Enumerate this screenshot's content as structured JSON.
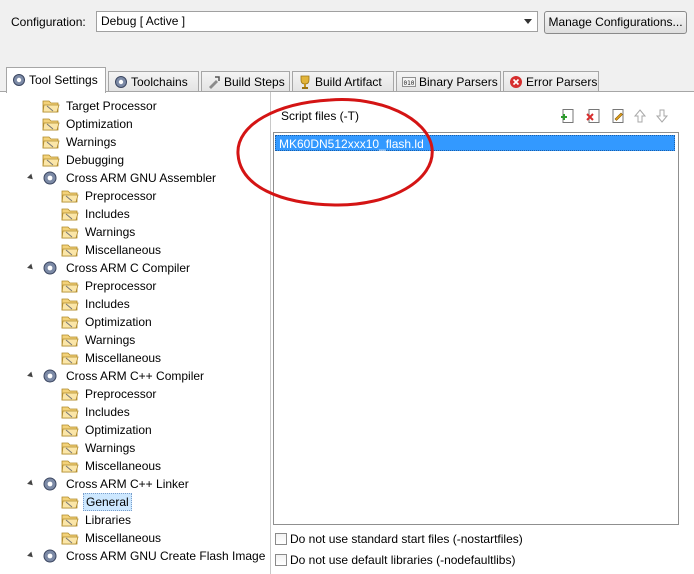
{
  "config": {
    "label": "Configuration:",
    "selected": "Debug  [ Active ]",
    "manage_button": "Manage Configurations..."
  },
  "tabs": [
    {
      "label": "Tool Settings",
      "icon": "gear-icon",
      "active": true
    },
    {
      "label": "Toolchains",
      "icon": "gear-icon",
      "active": false
    },
    {
      "label": "Build Steps",
      "icon": "build-steps-icon",
      "active": false
    },
    {
      "label": "Build Artifact",
      "icon": "trophy-icon",
      "active": false
    },
    {
      "label": "Binary Parsers",
      "icon": "binary-icon",
      "active": false
    },
    {
      "label": "Error Parsers",
      "icon": "error-icon",
      "active": false
    }
  ],
  "tree": [
    {
      "label": "Target Processor",
      "type": "folder",
      "level": 1
    },
    {
      "label": "Optimization",
      "type": "folder",
      "level": 1
    },
    {
      "label": "Warnings",
      "type": "folder",
      "level": 1
    },
    {
      "label": "Debugging",
      "type": "folder",
      "level": 1
    },
    {
      "label": "Cross ARM GNU Assembler",
      "type": "gear",
      "level": 0
    },
    {
      "label": "Preprocessor",
      "type": "folder",
      "level": 2
    },
    {
      "label": "Includes",
      "type": "folder",
      "level": 2
    },
    {
      "label": "Warnings",
      "type": "folder",
      "level": 2
    },
    {
      "label": "Miscellaneous",
      "type": "folder",
      "level": 2
    },
    {
      "label": "Cross ARM C Compiler",
      "type": "gear",
      "level": 0
    },
    {
      "label": "Preprocessor",
      "type": "folder",
      "level": 2
    },
    {
      "label": "Includes",
      "type": "folder",
      "level": 2
    },
    {
      "label": "Optimization",
      "type": "folder",
      "level": 2
    },
    {
      "label": "Warnings",
      "type": "folder",
      "level": 2
    },
    {
      "label": "Miscellaneous",
      "type": "folder",
      "level": 2
    },
    {
      "label": "Cross ARM C++ Compiler",
      "type": "gear",
      "level": 0
    },
    {
      "label": "Preprocessor",
      "type": "folder",
      "level": 2
    },
    {
      "label": "Includes",
      "type": "folder",
      "level": 2
    },
    {
      "label": "Optimization",
      "type": "folder",
      "level": 2
    },
    {
      "label": "Warnings",
      "type": "folder",
      "level": 2
    },
    {
      "label": "Miscellaneous",
      "type": "folder",
      "level": 2
    },
    {
      "label": "Cross ARM C++ Linker",
      "type": "gear",
      "level": 0
    },
    {
      "label": "General",
      "type": "folder",
      "level": 2,
      "selected": true
    },
    {
      "label": "Libraries",
      "type": "folder",
      "level": 2
    },
    {
      "label": "Miscellaneous",
      "type": "folder",
      "level": 2
    },
    {
      "label": "Cross ARM GNU Create Flash Image",
      "type": "gear",
      "level": 0
    }
  ],
  "script_files": {
    "label": "Script files (-T)",
    "items": [
      "MK60DN512xxx10_flash.ld"
    ],
    "toolbar": [
      "add-file-icon",
      "delete-file-icon",
      "edit-file-icon",
      "move-up-icon",
      "move-down-icon"
    ]
  },
  "options": [
    {
      "label": "Do not use standard start files (-nostartfiles)",
      "checked": false
    },
    {
      "label": "Do not use default libraries (-nodefaultlibs)",
      "checked": false
    }
  ],
  "colors": {
    "selection": "#3399ff",
    "annotation": "#d41414"
  }
}
